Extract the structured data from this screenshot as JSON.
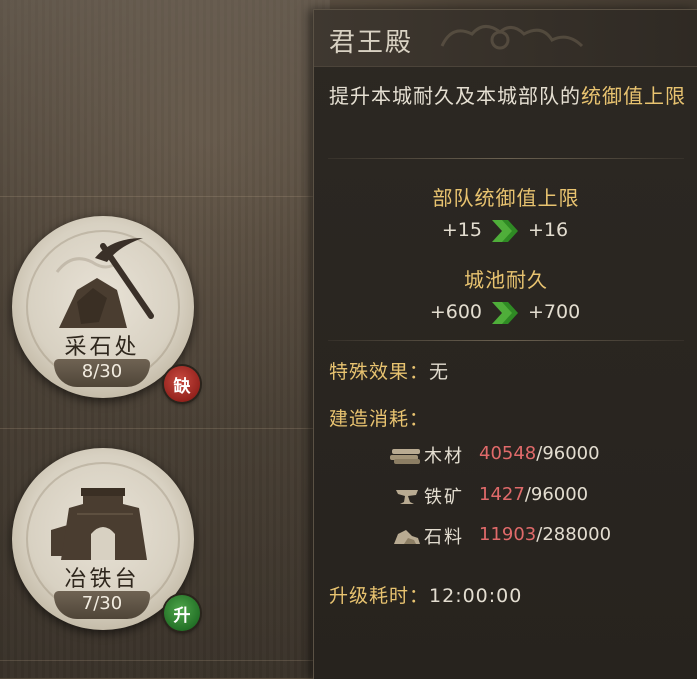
{
  "buildings": [
    {
      "name": "采石处",
      "count": "8/30",
      "badge": "缺",
      "badge_color": "#8d1d18"
    },
    {
      "name": "冶铁台",
      "count": "7/30",
      "badge": "升",
      "badge_color": "#1d6a22"
    }
  ],
  "tooltip": {
    "title": "君王殿",
    "description_prefix": "提升本城耐久及本城部队的",
    "description_highlight": "统御值上限",
    "stats": [
      {
        "label": "部队统御值上限",
        "from": "+15",
        "to": "+16"
      },
      {
        "label": "城池耐久",
        "from": "+600",
        "to": "+700"
      }
    ],
    "special_effect_label": "特殊效果：",
    "special_effect_value": "无",
    "cost_label": "建造消耗：",
    "costs": [
      {
        "icon": "wood-icon",
        "name": "木材",
        "have": "40548",
        "need": "/96000"
      },
      {
        "icon": "anvil-icon",
        "name": "铁矿",
        "have": "1427",
        "need": "/96000"
      },
      {
        "icon": "stone-icon",
        "name": "石料",
        "have": "11903",
        "need": "/288000"
      }
    ],
    "upgrade_time_label": "升级耗时：",
    "upgrade_time_value": "12:00:00"
  },
  "colors": {
    "highlight": "#e8c370",
    "insufficient": "#e06a6a",
    "arrow": "#4fae3a"
  }
}
